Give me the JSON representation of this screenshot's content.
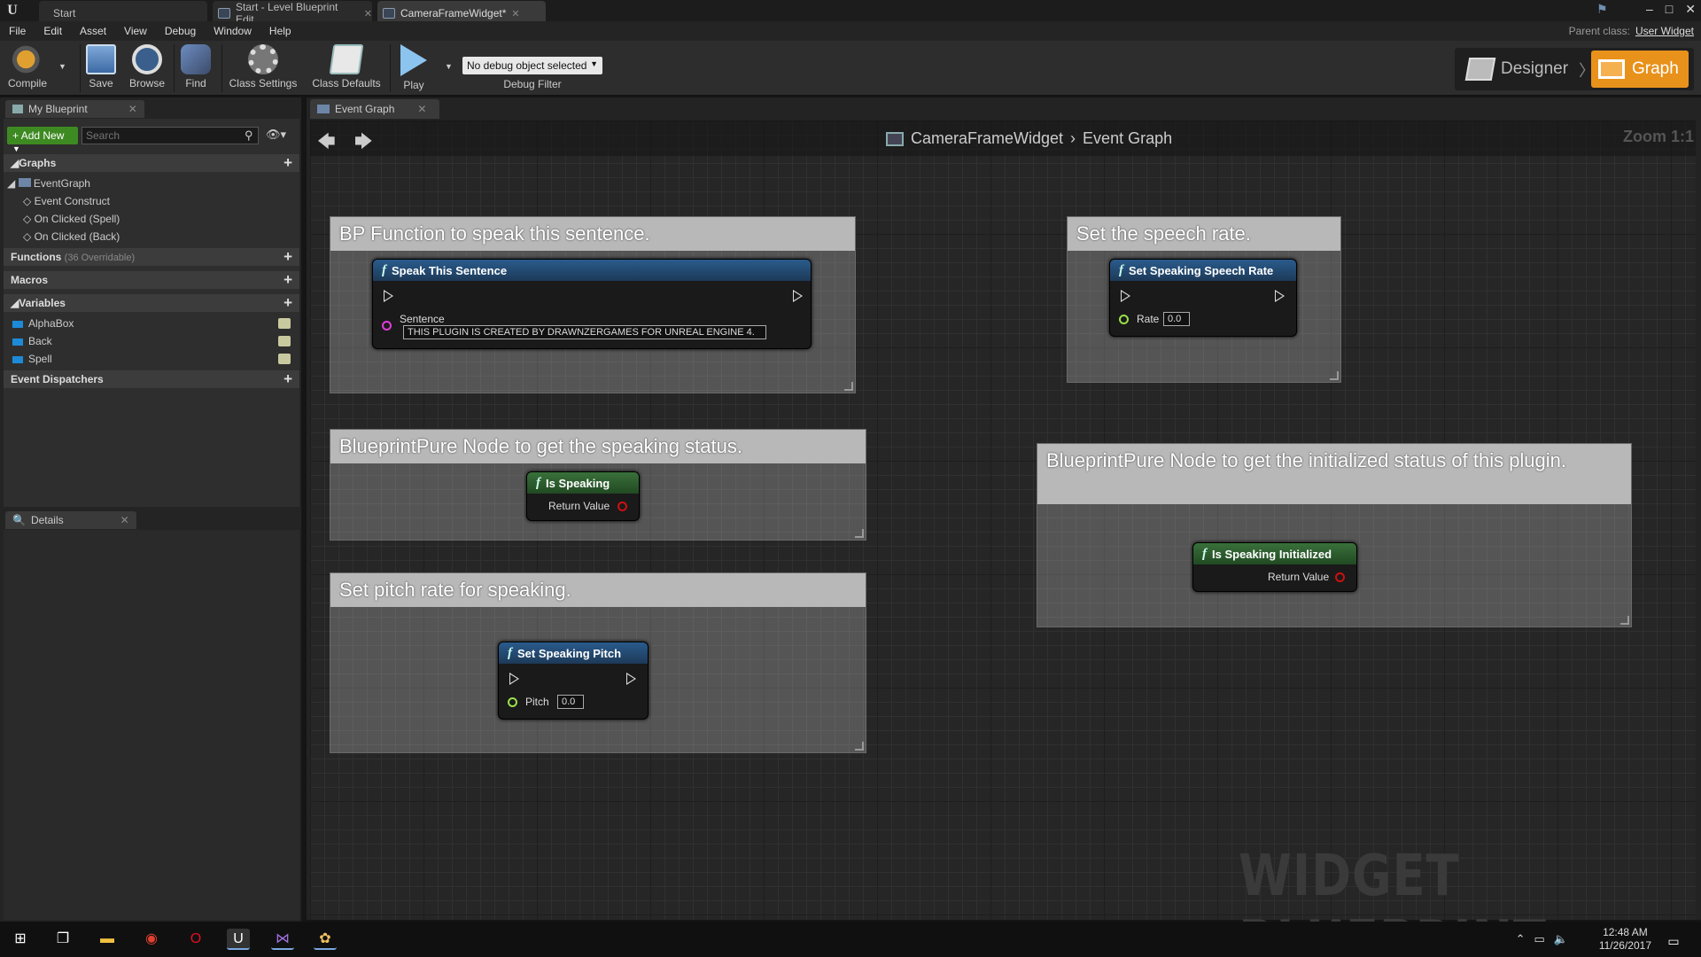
{
  "window": {
    "tabs": [
      {
        "label": "Start"
      },
      {
        "label": "Start - Level Blueprint Edit"
      },
      {
        "label": "CameraFrameWidget*"
      }
    ],
    "controls": [
      "–",
      "□",
      "✕"
    ]
  },
  "menu": {
    "items": [
      "File",
      "Edit",
      "Asset",
      "View",
      "Debug",
      "Window",
      "Help"
    ],
    "parent_class_label": "Parent class:",
    "parent_class_value": "User Widget"
  },
  "toolbar": {
    "compile": "Compile",
    "save": "Save",
    "browse": "Browse",
    "find": "Find",
    "class_settings": "Class Settings",
    "class_defaults": "Class Defaults",
    "play": "Play",
    "debug_select": "No debug object selected",
    "debug_filter": "Debug Filter",
    "mode_designer": "Designer",
    "mode_graph": "Graph"
  },
  "my_blueprint": {
    "tab": "My Blueprint",
    "add_new": "Add New",
    "search_placeholder": "Search",
    "graphs_header": "Graphs",
    "event_graph": "EventGraph",
    "events": [
      "Event Construct",
      "On Clicked (Spell)",
      "On Clicked (Back)"
    ],
    "functions_header": "Functions",
    "functions_overridable": "(36 Overridable)",
    "macros_header": "Macros",
    "variables_header": "Variables",
    "variables": [
      "AlphaBox",
      "Back",
      "Spell"
    ],
    "dispatchers_header": "Event Dispatchers"
  },
  "details": {
    "tab": "Details"
  },
  "graph": {
    "tab": "Event Graph",
    "breadcrumb_root": "CameraFrameWidget",
    "breadcrumb_leaf": "Event Graph",
    "zoom": "Zoom 1:1",
    "watermark": "WIDGET BLUEPRINT",
    "comments": {
      "speak": "BP Function to speak this sentence.",
      "rate": "Set the speech rate.",
      "status": "BlueprintPure Node to get the speaking status.",
      "initialized": "BlueprintPure Node to get the initialized status of this plugin.",
      "pitch": "Set pitch rate for speaking."
    },
    "nodes": {
      "speak": {
        "title": "Speak This Sentence",
        "pin": "Sentence",
        "value": "THIS PLUGIN IS CREATED BY DRAWNZERGAMES FOR UNREAL ENGINE 4."
      },
      "rate": {
        "title": "Set Speaking Speech Rate",
        "pin": "Rate",
        "value": "0.0"
      },
      "status": {
        "title": "Is Speaking",
        "pin": "Return Value"
      },
      "initialized": {
        "title": "Is Speaking Initialized",
        "pin": "Return Value"
      },
      "pitch": {
        "title": "Set Speaking Pitch",
        "pin": "Pitch",
        "value": "0.0"
      }
    },
    "colors": {
      "exec_pin": "#dddddd",
      "string_pin": "#e03cd8",
      "float_pin": "#9ae04a",
      "bool_pin": "#cc1111"
    }
  },
  "taskbar": {
    "time": "12:48 AM",
    "date": "11/26/2017"
  }
}
